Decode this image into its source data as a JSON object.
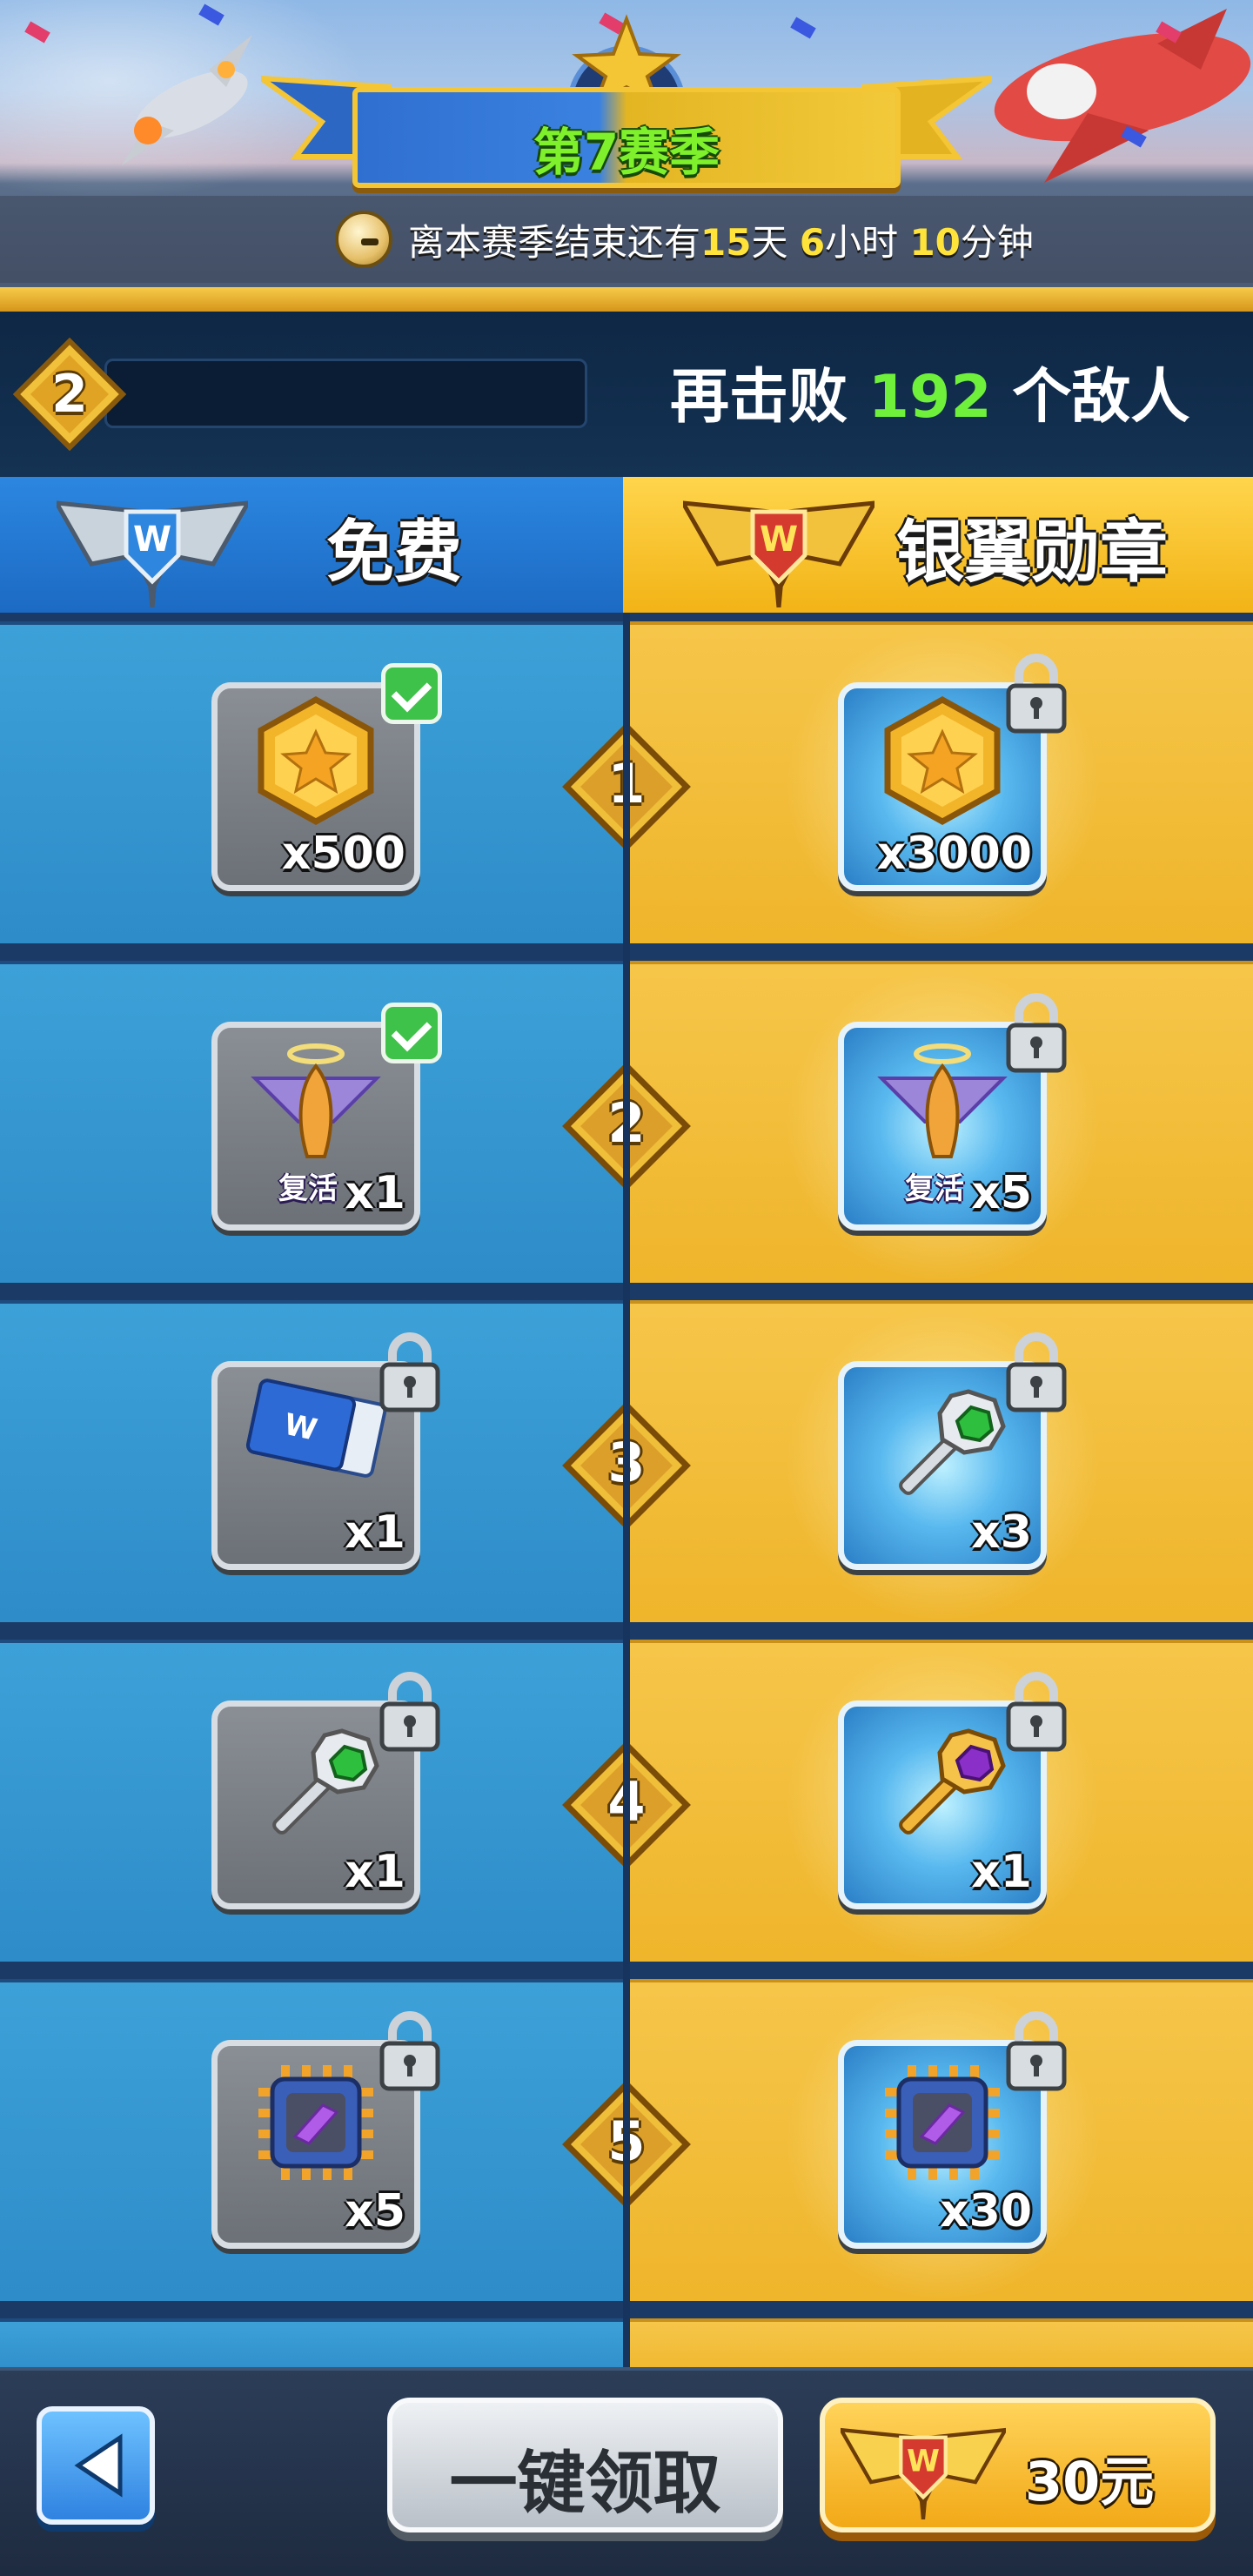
{
  "header": {
    "season_title": "第7赛季",
    "timer": {
      "prefix": "离本赛季结束还有",
      "days": "15",
      "days_unit": "天",
      "hours": "6",
      "hours_unit": "小时",
      "minutes": "10",
      "minutes_unit": "分钟"
    }
  },
  "progress": {
    "level": "2",
    "fill_fraction": 0.0,
    "enemies_prefix": "再击败",
    "enemies_count": "192",
    "enemies_suffix": "个敌人"
  },
  "tiers": {
    "free_label": "免费",
    "paid_label": "银翼勋章"
  },
  "rows": [
    {
      "level": "1",
      "free": {
        "icon": "gold-star-coin-icon",
        "qty": "x500",
        "claimed": true,
        "locked": false
      },
      "paid": {
        "icon": "gold-star-coin-icon",
        "qty": "x3000",
        "claimed": false,
        "locked": true
      }
    },
    {
      "level": "2",
      "free": {
        "icon": "revive-plane-icon",
        "caption": "复活",
        "qty": "x1",
        "claimed": true,
        "locked": false
      },
      "paid": {
        "icon": "revive-plane-icon",
        "caption": "复活",
        "qty": "x5",
        "claimed": false,
        "locked": true
      }
    },
    {
      "level": "3",
      "free": {
        "icon": "ticket-icon",
        "qty": "x1",
        "claimed": false,
        "locked": true
      },
      "paid": {
        "icon": "green-key-icon",
        "qty": "x3",
        "claimed": false,
        "locked": true
      }
    },
    {
      "level": "4",
      "free": {
        "icon": "green-key-icon",
        "qty": "x1",
        "claimed": false,
        "locked": true
      },
      "paid": {
        "icon": "purple-key-icon",
        "qty": "x1",
        "claimed": false,
        "locked": true
      }
    },
    {
      "level": "5",
      "free": {
        "icon": "chip-icon",
        "qty": "x5",
        "claimed": false,
        "locked": true
      },
      "paid": {
        "icon": "chip-icon",
        "qty": "x30",
        "claimed": false,
        "locked": true
      }
    }
  ],
  "footer": {
    "claim_all_label": "一键领取",
    "buy_label": "30元"
  },
  "colors": {
    "free_blue": "#2e8cc8",
    "paid_gold": "#efb52b",
    "enemies_green": "#6ff03a",
    "season_green": "#7ff02c"
  }
}
